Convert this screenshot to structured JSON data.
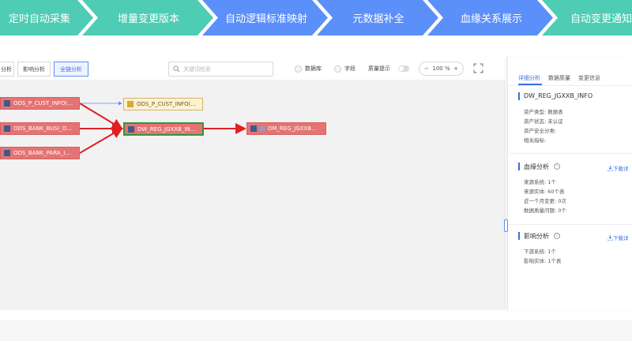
{
  "pipeline": {
    "steps": [
      {
        "label": "定时自动采集",
        "color": "#4ecdb4"
      },
      {
        "label": "增量变更版本",
        "color": "#4ecdb4"
      },
      {
        "label": "自动逻辑标准映射",
        "color": "#5b8ff9"
      },
      {
        "label": "元数据补全",
        "color": "#5b8ff9"
      },
      {
        "label": "血缘关系展示",
        "color": "#5b8ff9"
      },
      {
        "label": "自动变更通知",
        "color": "#4ecdb4"
      }
    ]
  },
  "toolbar": {
    "tabs": [
      "分析",
      "影响分析",
      "全链分析"
    ],
    "active_tab": "全链分析",
    "search_placeholder": "关键词检索",
    "filters": [
      "数据库",
      "字段"
    ],
    "quality_hint_label": "质量提示",
    "zoom_minus": "−",
    "zoom_level": "100 %",
    "zoom_plus": "+"
  },
  "graph": {
    "nodes": [
      {
        "id": "n1",
        "label": "ODS_P_CUST_INFO(…"
      },
      {
        "id": "n2",
        "label": "ODS_BANK_BUSI_O…"
      },
      {
        "id": "n3",
        "label": "ODS_BANK_PARA_I…"
      },
      {
        "id": "n4",
        "label": "ODS_P_CUST_INFO(…"
      },
      {
        "id": "n5",
        "label": "DW_REG_JGXXB_IN…"
      },
      {
        "id": "n6",
        "label": "DM_REG_JGXXB…"
      }
    ],
    "colors": {
      "source": "#e57373",
      "selected_border": "#2e9a38",
      "edge": "#e02020",
      "edge_thin": "#5b8ff9"
    }
  },
  "panel": {
    "tabs": [
      "详细分析",
      "数据质量",
      "变更信息"
    ],
    "active_tab": "详细分析",
    "asset_name": "DW_REG_JGXXB_INFO",
    "asset_info": [
      "资产类型:  数据表",
      "资产状态:  未认证",
      "资产安全分类:",
      "相关指标:"
    ],
    "lineage": {
      "title": "血缘分析",
      "download": "下载详",
      "items": [
        "来源系统:  1个",
        "来源实体:  60个表",
        "近一个月变更:  0次",
        "数据质量问题:  0个"
      ]
    },
    "impact": {
      "title": "影响分析",
      "download": "下载详",
      "items": [
        "下游系统:  1个",
        "影响实体:  1个表"
      ]
    }
  }
}
